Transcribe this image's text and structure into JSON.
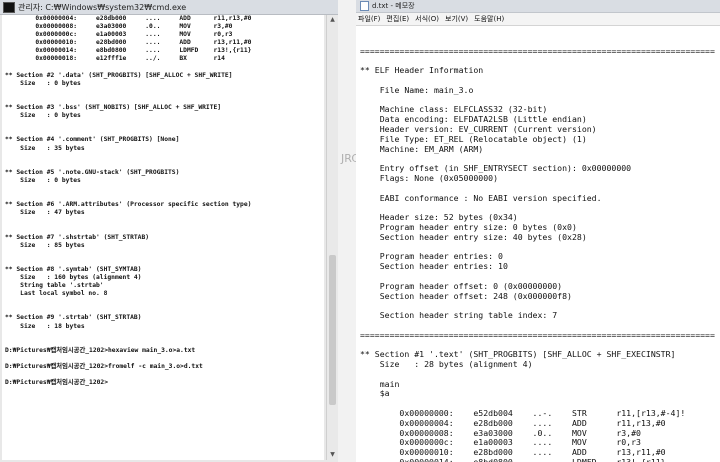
{
  "cmd": {
    "title": "관리자: C:₩Windows₩system32₩cmd.exe",
    "lines": [
      "        0x00000004:     e28db000     ....     ADD      r11,r13,#0",
      "        0x00000008:     e3a03000     .0..     MOV      r3,#0",
      "        0x0000000c:     e1a00003     ....     MOV      r0,r3",
      "        0x00000010:     e28bd000     ....     ADD      r13,r11,#0",
      "        0x00000014:     e8bd0800     ....     LDMFD    r13!,{r11}",
      "        0x00000018:     e12fff1e     ../.     BX       r14",
      "",
      "** Section #2 '.data' (SHT_PROGBITS) [SHF_ALLOC + SHF_WRITE]",
      "    Size   : 0 bytes",
      "",
      "",
      "** Section #3 '.bss' (SHT_NOBITS) [SHF_ALLOC + SHF_WRITE]",
      "    Size   : 0 bytes",
      "",
      "",
      "** Section #4 '.comment' (SHT_PROGBITS) [None]",
      "    Size   : 35 bytes",
      "",
      "",
      "** Section #5 '.note.GNU-stack' (SHT_PROGBITS)",
      "    Size   : 0 bytes",
      "",
      "",
      "** Section #6 '.ARM.attributes' (Processor specific section type)",
      "    Size   : 47 bytes",
      "",
      "",
      "** Section #7 '.shstrtab' (SHT_STRTAB)",
      "    Size   : 85 bytes",
      "",
      "",
      "** Section #8 '.symtab' (SHT_SYMTAB)",
      "    Size   : 160 bytes (alignment 4)",
      "    String table '.strtab'",
      "    Last local symbol no. 8",
      "",
      "",
      "** Section #9 '.strtab' (SHT_STRTAB)",
      "    Size   : 18 bytes",
      "",
      "",
      "D:₩Pictures₩캡처임시공간_1202>hexaview main_3.o>a.txt",
      "",
      "D:₩Pictures₩캡처임시공간_1202>fromelf -c main_3.o>d.txt",
      "",
      "D:₩Pictures₩캡처임시공간_1202>"
    ]
  },
  "strip": {
    "peek_text": "JRC"
  },
  "notepad": {
    "title": "d.txt - 메모장",
    "menu": [
      "파일(F)",
      "편집(E)",
      "서식(O)",
      "보기(V)",
      "도움말(H)"
    ],
    "lines": [
      "",
      "",
      "========================================================================",
      "",
      "** ELF Header Information",
      "",
      "    File Name: main_3.o",
      "",
      "    Machine class: ELFCLASS32 (32-bit)",
      "    Data encoding: ELFDATA2LSB (Little endian)",
      "    Header version: EV_CURRENT (Current version)",
      "    File Type: ET_REL (Relocatable object) (1)",
      "    Machine: EM_ARM (ARM)",
      "",
      "    Entry offset (in SHF_ENTRYSECT section): 0x00000000",
      "    Flags: None (0x05000000)",
      "",
      "    EABI conformance : No EABI version specified.",
      "",
      "    Header size: 52 bytes (0x34)",
      "    Program header entry size: 0 bytes (0x0)",
      "    Section header entry size: 40 bytes (0x28)",
      "",
      "    Program header entries: 0",
      "    Section header entries: 10",
      "",
      "    Program header offset: 0 (0x00000000)",
      "    Section header offset: 248 (0x000000f8)",
      "",
      "    Section header string table index: 7",
      "",
      "========================================================================",
      "",
      "** Section #1 '.text' (SHT_PROGBITS) [SHF_ALLOC + SHF_EXECINSTR]",
      "    Size   : 28 bytes (alignment 4)",
      "",
      "    main",
      "    $a",
      "",
      "        0x00000000:    e52db004    ..-.    STR      r11,[r13,#-4]!",
      "        0x00000004:    e28db000    ....    ADD      r11,r13,#0",
      "        0x00000008:    e3a03000    .0..    MOV      r3,#0",
      "        0x0000000c:    e1a00003    ....    MOV      r0,r3",
      "        0x00000010:    e28bd000    ....    ADD      r13,r11,#0",
      "        0x00000014:    e8bd0800    ....    LDMFD    r13!,{r11}"
    ]
  }
}
